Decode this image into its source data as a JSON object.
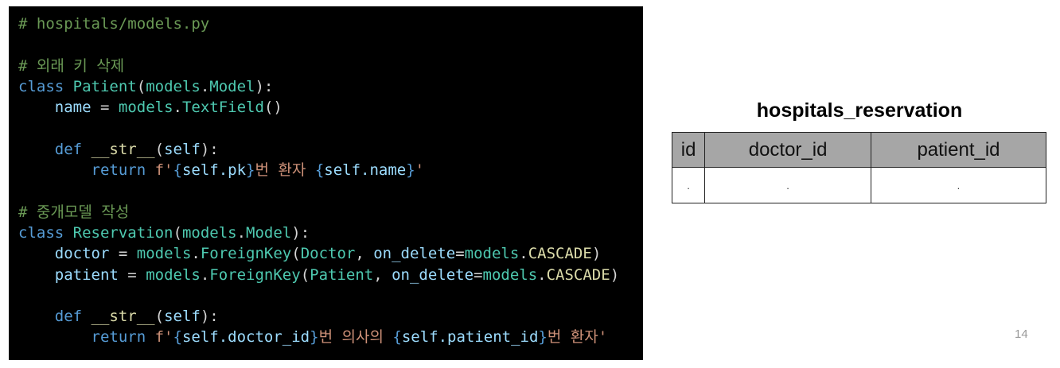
{
  "code": {
    "file_comment": "# hospitals/models.py",
    "comment_delete": "# 외래 키 삭제",
    "patient_class": {
      "keyword": "class",
      "name": "Patient",
      "base_module": "models",
      "base_class": "Model",
      "field_name": "name",
      "field_module": "models",
      "field_type": "TextField"
    },
    "patient_str": {
      "def_keyword": "def",
      "method": "__str__",
      "param": "self",
      "return_keyword": "return",
      "fstring_prefix": "f'",
      "expr1": "self.pk",
      "text1": "번 환자 ",
      "expr2": "self.name",
      "quote_end": "'"
    },
    "comment_intermediate": "# 중개모델 작성",
    "reservation_class": {
      "keyword": "class",
      "name": "Reservation",
      "base_module": "models",
      "base_class": "Model",
      "field1_name": "doctor",
      "field1_ref": "Doctor",
      "field2_name": "patient",
      "field2_ref": "Patient",
      "fk_module": "models",
      "fk_type": "ForeignKey",
      "on_delete_kw": "on_delete",
      "cascade_module": "models",
      "cascade": "CASCADE"
    },
    "reservation_str": {
      "def_keyword": "def",
      "method": "__str__",
      "param": "self",
      "return_keyword": "return",
      "fstring_prefix": "f'",
      "expr1": "self.doctor_id",
      "text1": "번 의사의 ",
      "expr2": "self.patient_id",
      "text2": "번 환자",
      "quote_end": "'"
    }
  },
  "table": {
    "title": "hospitals_reservation",
    "columns": [
      "id",
      "doctor_id",
      "patient_id"
    ],
    "rows": [
      [
        ".",
        ".",
        "."
      ]
    ]
  },
  "page_number": "14",
  "colors": {
    "code_background": "#000000",
    "table_header": "#a6a6a6"
  }
}
